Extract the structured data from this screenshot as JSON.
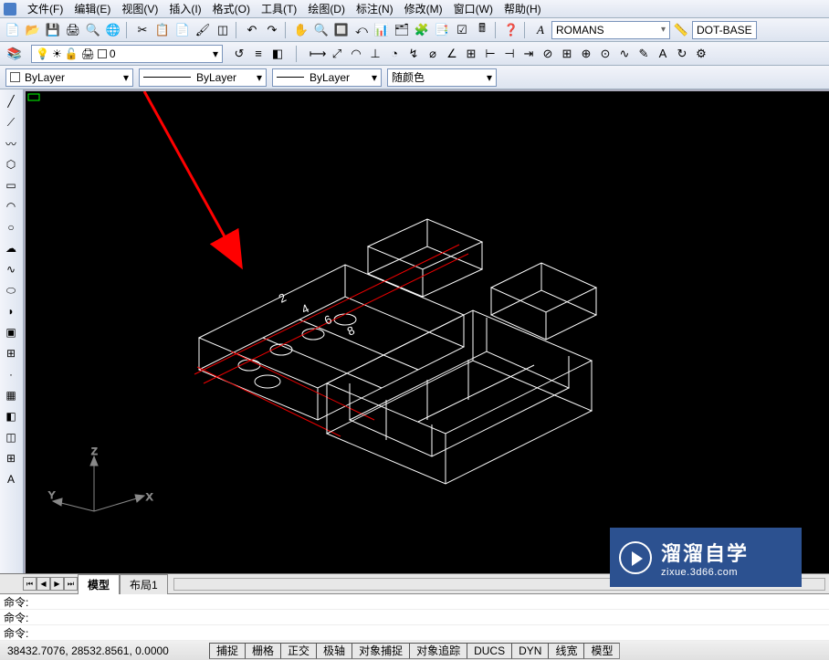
{
  "menu": {
    "file": "文件(F)",
    "edit": "编辑(E)",
    "view": "视图(V)",
    "insert": "插入(I)",
    "format": "格式(O)",
    "tools": "工具(T)",
    "draw": "绘图(D)",
    "dimension": "标注(N)",
    "modify": "修改(M)",
    "window": "窗口(W)",
    "help": "帮助(H)"
  },
  "style_controls": {
    "text_style": "ROMANS",
    "dim_style": "DOT-BASE"
  },
  "layer_dropdown": "0",
  "properties": {
    "color_label": "ByLayer",
    "linetype_label": "ByLayer",
    "lineweight_label": "ByLayer",
    "plotstyle_label": "随颜色"
  },
  "ucs": {
    "x": "X",
    "y": "Y",
    "z": "Z"
  },
  "tabs": {
    "model": "模型",
    "layout1": "布局1"
  },
  "cmd": {
    "prompt": "命令:"
  },
  "status": {
    "coords": "38432.7076, 28532.8561, 0.0000",
    "snap": "捕捉",
    "grid": "栅格",
    "ortho": "正交",
    "polar": "极轴",
    "osnap": "对象捕捉",
    "otrack": "对象追踪",
    "ducs": "DUCS",
    "dyn": "DYN",
    "lwt": "线宽",
    "model": "模型"
  },
  "watermark": {
    "title": "溜溜自学",
    "url": "zixue.3d66.com"
  }
}
